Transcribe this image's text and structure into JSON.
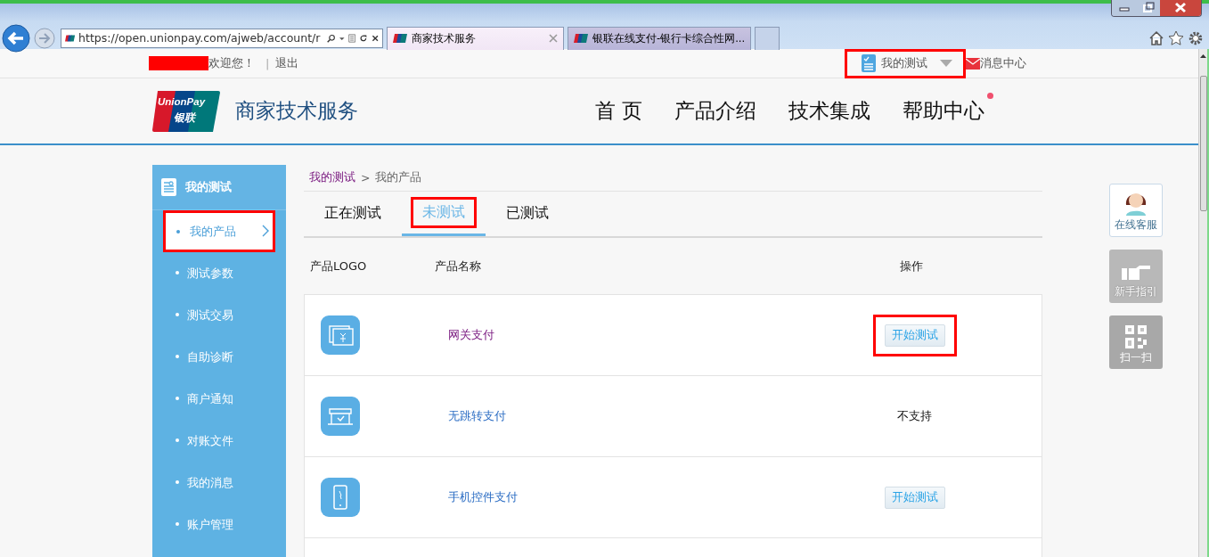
{
  "browser": {
    "address": "https://open.unionpay.com/ajweb/account/r",
    "tabs": [
      {
        "label": "商家技术服务",
        "selected": true
      },
      {
        "label": "银联在线支付-银行卡综合性网...",
        "selected": false
      }
    ]
  },
  "topbar": {
    "welcome": "欢迎您！",
    "separator": "|",
    "logout": "退出",
    "menu": {
      "label": "我的测试",
      "highlighted": true
    },
    "messages": "消息中心"
  },
  "header": {
    "logo": {
      "line1": "UnionPay",
      "line2": "银联"
    },
    "brand": "商家技术服务",
    "nav": [
      {
        "label": "首 页",
        "badge": false
      },
      {
        "label": "产品介绍",
        "badge": false
      },
      {
        "label": "技术集成",
        "badge": false
      },
      {
        "label": "帮助中心",
        "badge": true
      }
    ]
  },
  "sidebar": {
    "title": "我的测试",
    "items": [
      {
        "label": "我的产品",
        "selected": true,
        "highlighted": true
      },
      {
        "label": "测试参数",
        "selected": false,
        "highlighted": false
      },
      {
        "label": "测试交易",
        "selected": false,
        "highlighted": false
      },
      {
        "label": "自助诊断",
        "selected": false,
        "highlighted": false
      },
      {
        "label": "商户通知",
        "selected": false,
        "highlighted": false
      },
      {
        "label": "对账文件",
        "selected": false,
        "highlighted": false
      },
      {
        "label": "我的消息",
        "selected": false,
        "highlighted": false
      },
      {
        "label": "账户管理",
        "selected": false,
        "highlighted": false
      }
    ]
  },
  "breadcrumb": {
    "parent": "我的测试",
    "separator": ">",
    "current": "我的产品"
  },
  "tabs": [
    {
      "label": "正在测试",
      "selected": false,
      "highlighted": false
    },
    {
      "label": "未测试",
      "selected": true,
      "highlighted": true
    },
    {
      "label": "已测试",
      "selected": false,
      "highlighted": false
    }
  ],
  "table": {
    "columns": [
      "产品LOGO",
      "产品名称",
      "操作"
    ],
    "rows": [
      {
        "kind": "gateway",
        "name": "网关支付",
        "visited": true,
        "action": {
          "kind": "button",
          "label": "开始测试",
          "highlighted": true
        }
      },
      {
        "kind": "store",
        "name": "无跳转支付",
        "visited": false,
        "action": {
          "kind": "text",
          "label": "不支持"
        }
      },
      {
        "kind": "phone",
        "name": "手机控件支付",
        "visited": false,
        "action": {
          "kind": "button",
          "label": "开始测试",
          "highlighted": false
        }
      }
    ]
  },
  "side_tools": [
    {
      "kind": "avatar",
      "label": "在线客服"
    },
    {
      "kind": "hand",
      "label": "新手指引",
      "disabled": true
    },
    {
      "kind": "qr",
      "label": "扫一扫",
      "disabled": false
    }
  ]
}
